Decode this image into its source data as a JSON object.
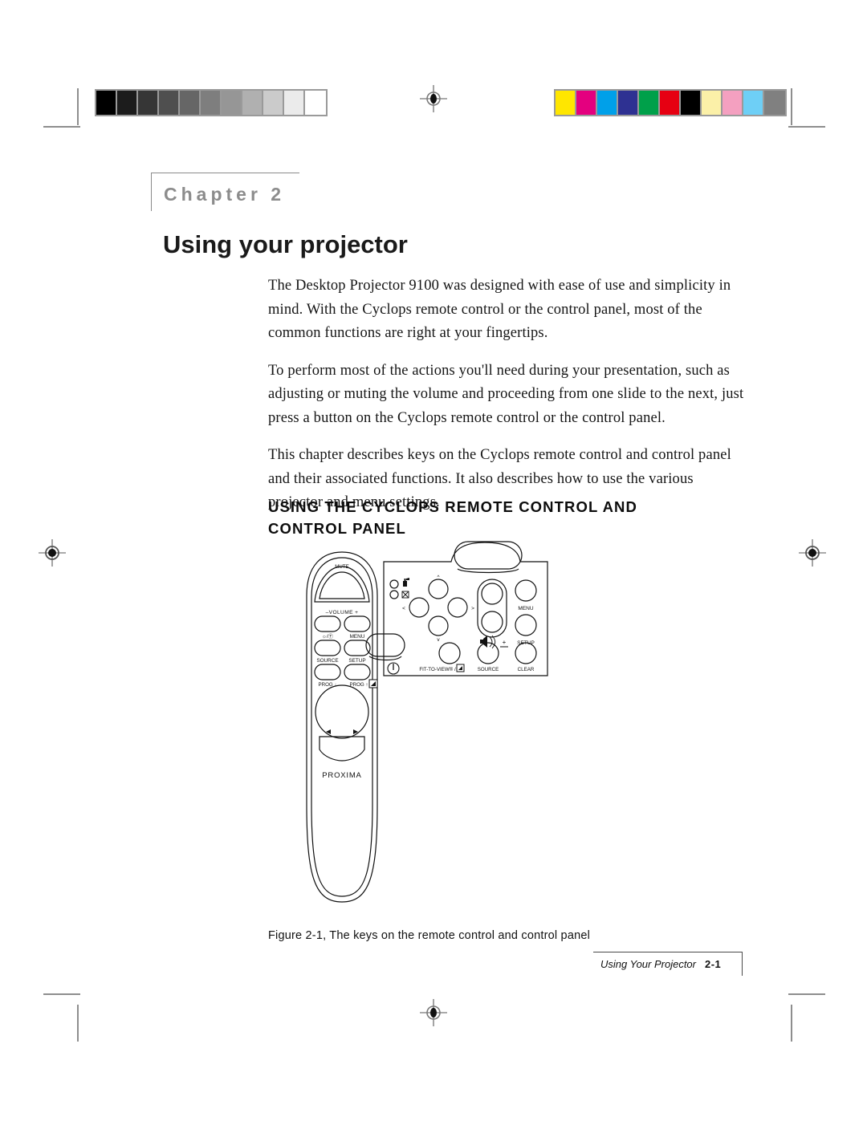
{
  "page": {
    "chapter_label": "Chapter 2",
    "chapter_title": "Using your projector",
    "paragraphs": [
      "The Desktop Projector 9100 was designed with ease of use and simplicity in mind. With the Cyclops remote control or the control panel, most of the common functions are right at your fingertips.",
      "To perform most of the actions you'll need during your presentation, such as adjusting or muting the volume and proceeding from one slide to the next, just press a button on the Cyclops remote control or the control panel.",
      "This chapter describes keys on the Cyclops remote control and control panel and their associated functions. It also describes how to use the various projector and menu settings."
    ],
    "section_heading": "USING THE CYCLOPS REMOTE CONTROL AND CONTROL PANEL",
    "figure_caption": "Figure 2-1, The keys on the remote control and control panel",
    "footer_text": "Using Your Projector",
    "footer_page": "2-1"
  },
  "figure": {
    "remote": {
      "brand": "PROXIMA",
      "buttons": [
        "MUTE",
        "–VOLUME +",
        "☼ / ①",
        "MENU",
        "SOURCE",
        "SETUP",
        "PROG ↓",
        "PROG ↑"
      ],
      "mute_label": "MUTE",
      "volume_label": "–VOLUME +",
      "power_label": "☀/⏻",
      "menu_label": "MENU",
      "source_label": "SOURCE",
      "setup_label": "SETUP",
      "prog_down_label": "PROG ↓",
      "prog_up_label": "PROG ↑"
    },
    "panel": {
      "up_label": "^",
      "down_label": "v",
      "left_label": "<",
      "right_label": ">",
      "volume_label": "◁\u0001)) +",
      "menu_label": "MENU",
      "setup_label": "SETUP",
      "fit_to_view_label": "FIT-TO-VIEW® /",
      "source_label": "SOURCE",
      "clear_label": "CLEAR",
      "power_label": "Ⓕ"
    }
  },
  "prepress": {
    "grayscale_bar": [
      "#000000",
      "#1c1c1c",
      "#363636",
      "#4f4f4f",
      "#666666",
      "#7e7e7e",
      "#969696",
      "#b0b0b0",
      "#cbcbcb",
      "#ebebeb",
      "#ffffff"
    ],
    "color_bar": [
      "#ffe600",
      "#e4007f",
      "#00a0e9",
      "#2e3192",
      "#00a04a",
      "#e60012",
      "#000000",
      "#fbf0a8",
      "#f4a0c0",
      "#6ecff6",
      "#808080"
    ],
    "registration_mark": "registration-target"
  }
}
